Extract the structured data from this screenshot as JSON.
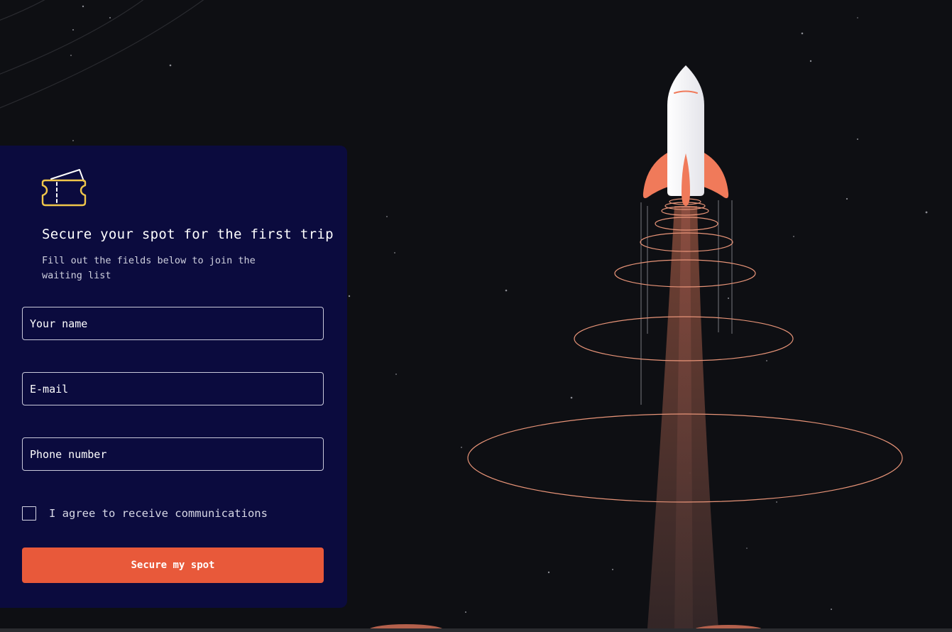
{
  "form": {
    "title": "Secure your spot for the first trip",
    "subtitle": "Fill out the fields below to join the waiting list",
    "name_placeholder": "Your name",
    "email_placeholder": "E-mail",
    "phone_placeholder": "Phone number",
    "consent_label": "I agree to receive communications",
    "consent_checked": false,
    "submit_label": "Secure my spot",
    "icon": "ticket-icon"
  },
  "illustration": {
    "icon": "rocket-icon"
  },
  "colors": {
    "background": "#0e0f13",
    "panel": "#0b0b3e",
    "accent": "#e8593a",
    "ticket": "#f0c64a",
    "ring": "#e89478"
  }
}
